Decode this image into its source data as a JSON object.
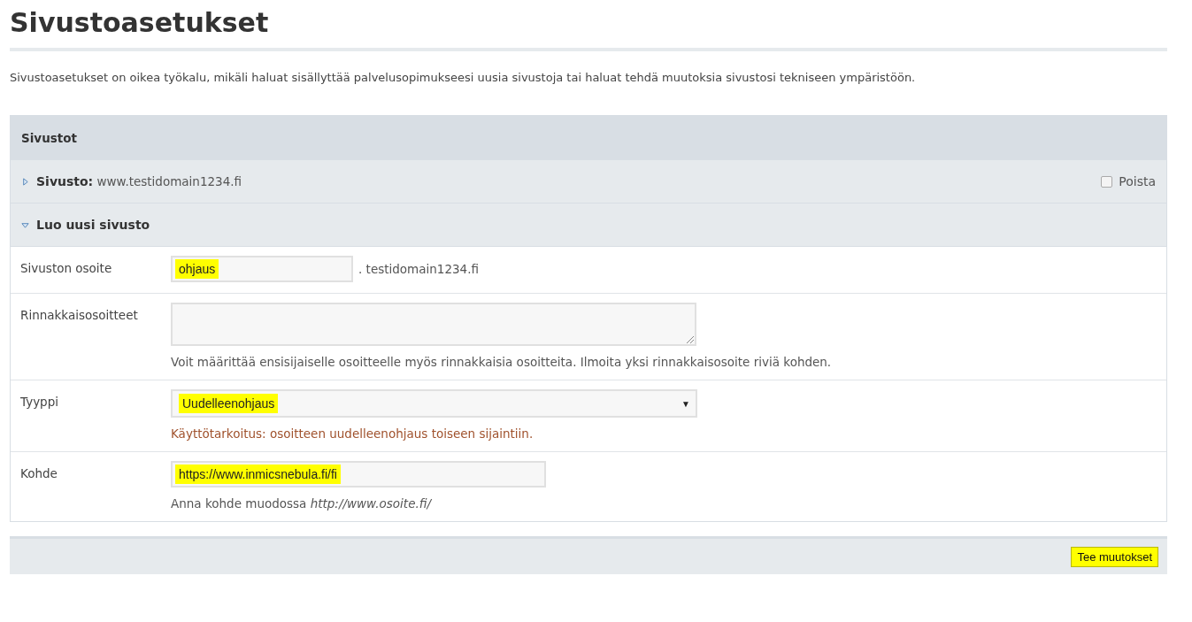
{
  "title": "Sivustoasetukset",
  "description": "Sivustoasetukset on oikea työkalu, mikäli haluat sisällyttää palvelusopimukseesi uusia sivustoja tai haluat tehdä muutoksia sivustosi tekniseen ympäristöön.",
  "panel": {
    "title": "Sivustot",
    "sections": [
      {
        "label": "Sivusto:",
        "value": "www.testidomain1234.fi",
        "expanded": false,
        "delete_label": "Poista",
        "delete_checked": false
      },
      {
        "label": "Luo uusi sivusto",
        "expanded": true
      }
    ],
    "fields": [
      {
        "kind": "text",
        "label": "Sivuston osoite",
        "value": "ohjaus",
        "highlighted": true,
        "suffix": ". testidomain1234.fi"
      },
      {
        "kind": "textarea",
        "label": "Rinnakkaisosoitteet",
        "help": "Voit määrittää ensisijaiselle osoitteelle myös rinnakkaisia osoitteita. Ilmoita yksi rinnakkaisosoite riviä kohden."
      },
      {
        "kind": "select",
        "label": "Tyyppi",
        "value": "Uudelleenohjaus",
        "highlighted": true,
        "arrow": "▼",
        "help": "Käyttötarkoitus: osoitteen uudelleenohjaus toiseen sijaintiin.",
        "help_warning": true
      },
      {
        "kind": "url",
        "label": "Kohde",
        "value": "https://www.inmicsnebula.fi/fi",
        "highlighted": true,
        "help": "Anna kohde muodossa *http://www.osoite.fi/*"
      }
    ]
  },
  "footer": {
    "button": {
      "label": "Tee muutokset",
      "highlighted": true
    }
  }
}
